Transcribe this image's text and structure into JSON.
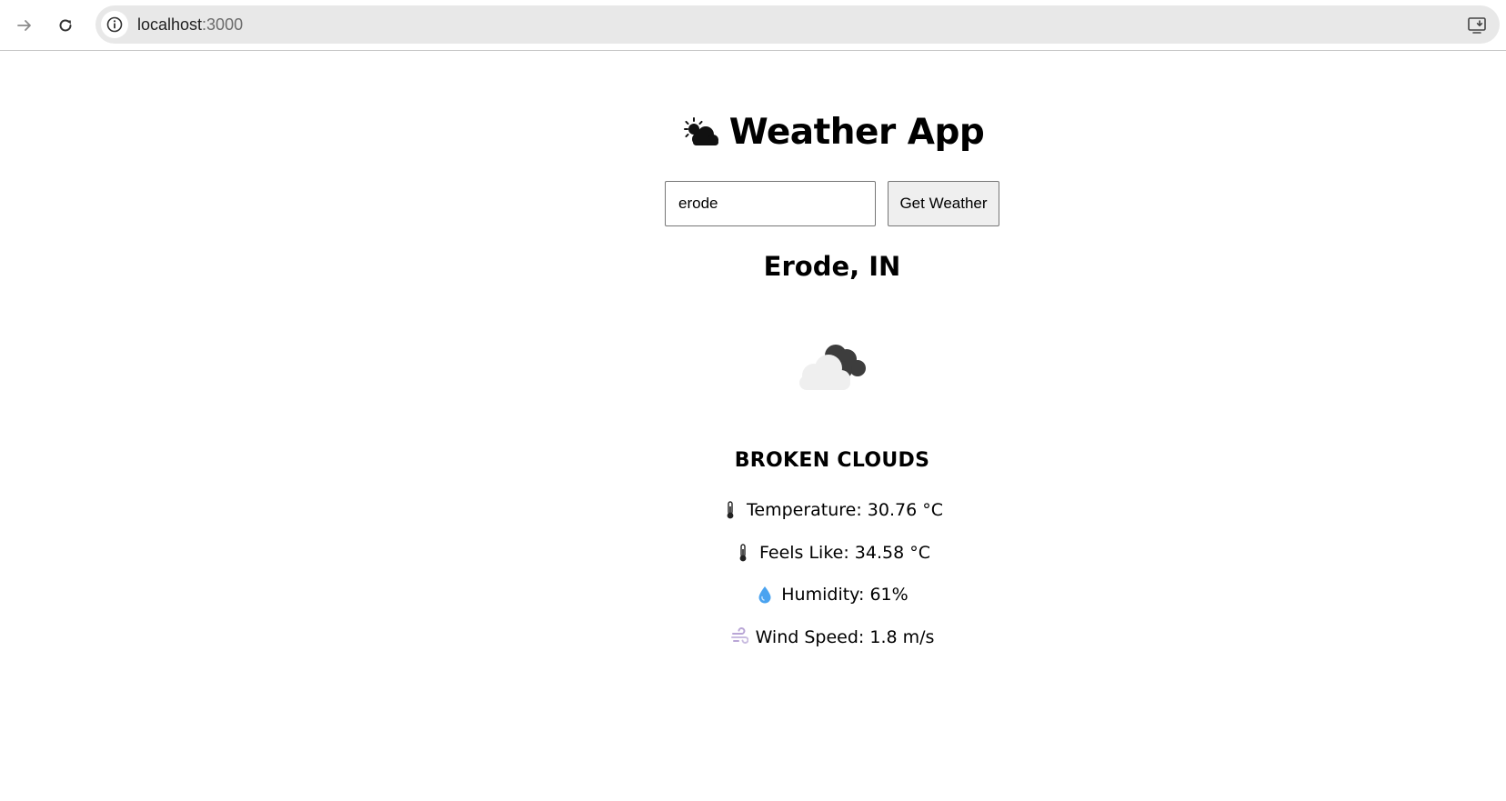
{
  "browser": {
    "url_host": "localhost",
    "url_port": ":3000",
    "icons": {
      "forward": "arrow-right-icon",
      "reload": "reload-icon",
      "info": "info-icon",
      "install": "install-app-icon"
    }
  },
  "app": {
    "title_icon": "sun-behind-cloud-icon",
    "title": "Weather App",
    "search": {
      "value": "erode",
      "button_label": "Get Weather"
    },
    "result": {
      "city": "Erode, IN",
      "condition_icon": "broken-clouds-icon",
      "description": "BROKEN CLOUDS",
      "stats": {
        "temperature": {
          "icon": "thermometer-icon",
          "text": "Temperature: 30.76 °C"
        },
        "feels_like": {
          "icon": "thermometer-icon",
          "text": "Feels Like: 34.58 °C"
        },
        "humidity": {
          "icon": "droplet-icon",
          "text": "Humidity: 61%"
        },
        "wind_speed": {
          "icon": "wind-icon",
          "text": "Wind Speed: 1.8 m/s"
        }
      }
    }
  },
  "colors": {
    "page_bg": "#ffffff",
    "address_bar_bg": "#e8e8e8",
    "button_bg": "#efefef",
    "droplet": "#4aa3f0",
    "cloud_light": "#efefef",
    "cloud_dark": "#3d3d3d"
  }
}
